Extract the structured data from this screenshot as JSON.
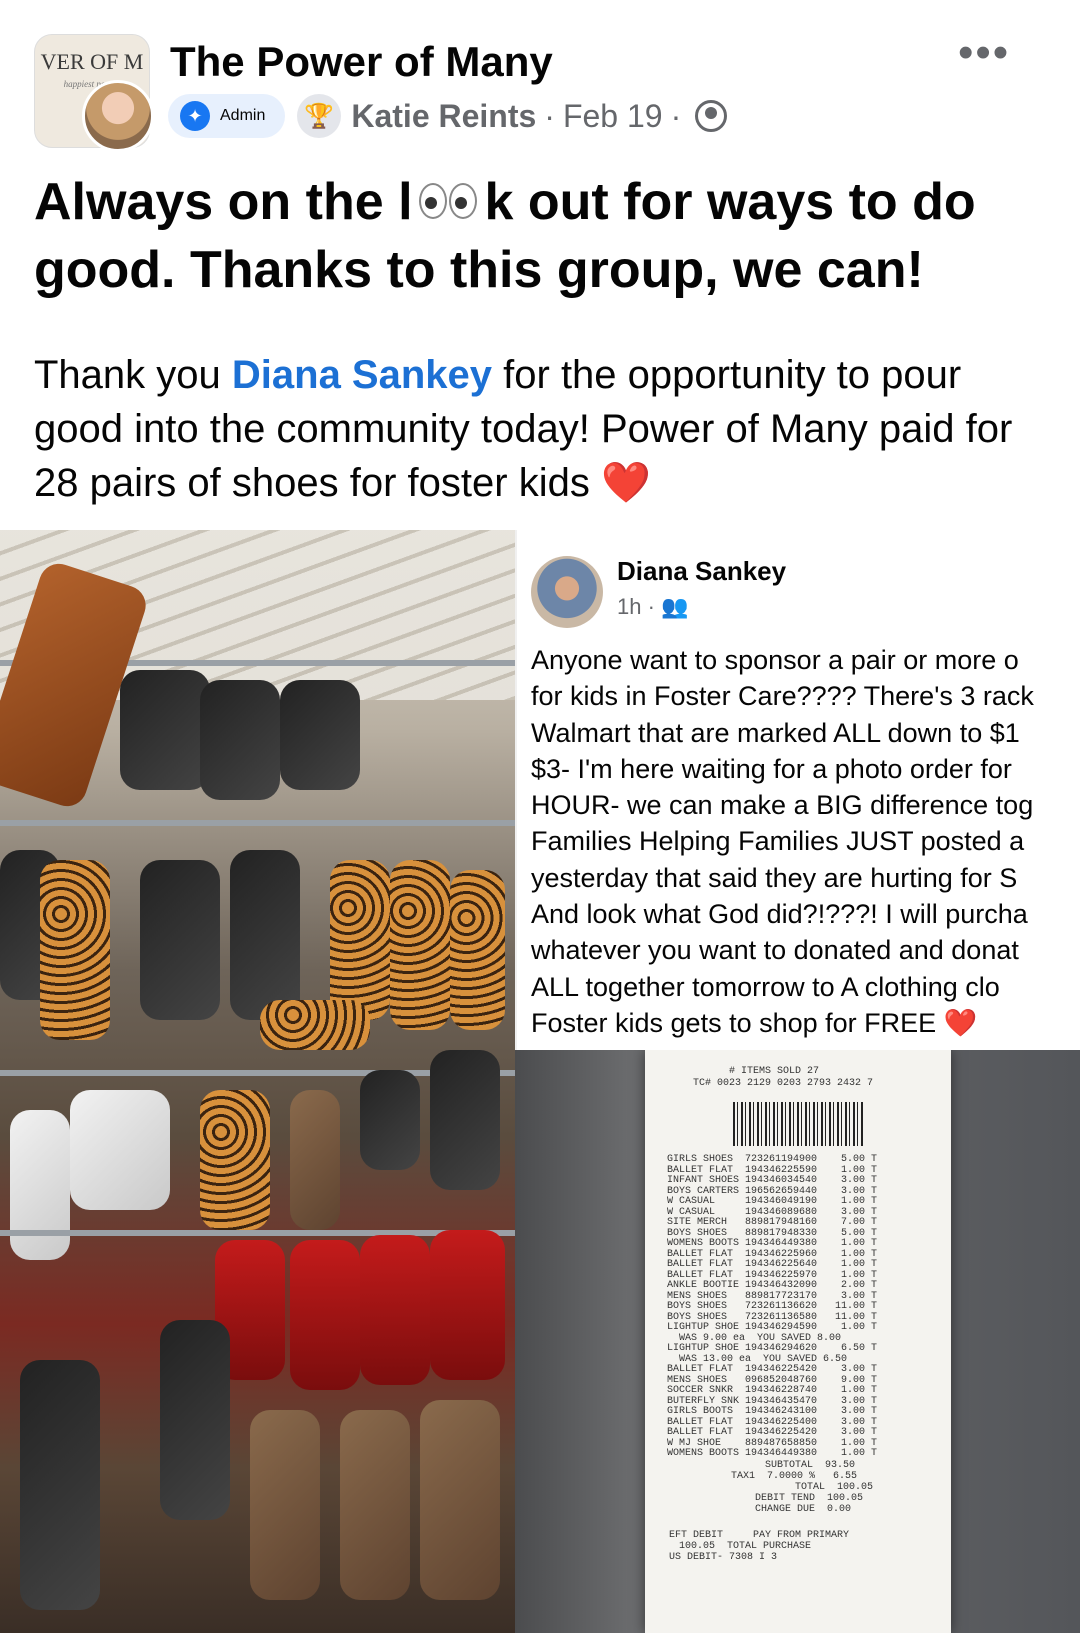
{
  "post": {
    "group_name": "The Power of Many",
    "group_logo_text": "VER OF M",
    "group_logo_sub": "happiest people",
    "admin_label": "Admin",
    "author": "Katie Reints",
    "date": "Feb 19",
    "headline_part1": "Always on the l",
    "headline_part2": "k out for ways to do good. Thanks to this group, we can!",
    "body_part1": "Thank you ",
    "mention": "Diana Sankey",
    "body_part2": " for the opportunity to pour good into the community today! Power of Many paid for 28 pairs of shoes for foster kids ",
    "heart": "❤️"
  },
  "shared_post": {
    "name": "Diana Sankey",
    "time": "1h ·",
    "text_lines": [
      "Anyone want to sponsor a pair or more o",
      "for kids in Foster Care???? There's 3 rack",
      "Walmart that are marked ALL down to $1",
      "$3- I'm here waiting for a photo order for",
      "HOUR- we can make a BIG difference tog",
      "Families Helping Families JUST posted a",
      "yesterday that said they are hurting for S",
      "And look what God did?!???! I will purcha",
      "whatever you want to donated and donat",
      "ALL together tomorrow to A clothing clo",
      "Foster kids gets to shop for FREE"
    ],
    "heart": "❤️"
  },
  "receipt": {
    "items_sold": "# ITEMS SOLD 27",
    "tc": "TC# 0023 2129 0203 2793 2432 7",
    "lines": [
      "GIRLS SHOES  723261194900    5.00 T",
      "BALLET FLAT  194346225590    1.00 T",
      "INFANT SHOES 194346034540    3.00 T",
      "BOYS CARTERS 196562659440    3.00 T",
      "W CASUAL     194346049190    1.00 T",
      "W CASUAL     194346089680    3.00 T",
      "SITE MERCH   889817948160    7.00 T",
      "BOYS SHOES   889817948330    5.00 T",
      "WOMENS BOOTS 194346449380    1.00 T",
      "BALLET FLAT  194346225960    1.00 T",
      "BALLET FLAT  194346225640    1.00 T",
      "BALLET FLAT  194346225970    1.00 T",
      "ANKLE BOOTIE 194346432090    2.00 T",
      "MENS SHOES   889817723170    3.00 T",
      "BOYS SHOES   723261136620   11.00 T",
      "BOYS SHOES   723261136580   11.00 T",
      "LIGHTUP SHOE 194346294590    1.00 T",
      "  WAS 9.00 ea  YOU SAVED 8.00",
      "LIGHTUP SHOE 194346294620    6.50 T",
      "  WAS 13.00 ea  YOU SAVED 6.50",
      "BALLET FLAT  194346225420    3.00 T",
      "MENS SHOES   096852048760    9.00 T",
      "SOCCER SNKR  194346228740    1.00 T",
      "BUTERFLY SNK 194346435470    3.00 T",
      "GIRLS BOOTS  194346243100    3.00 T",
      "BALLET FLAT  194346225400    3.00 T",
      "BALLET FLAT  194346225420    3.00 T",
      "W MJ SHOE    889487658850    1.00 T",
      "WOMENS BOOTS 194346449380    1.00 T"
    ],
    "subtotal_line": "SUBTOTAL  93.50",
    "tax_line": "TAX1  7.0000 %   6.55",
    "total_line": "TOTAL  100.05",
    "debit_line": "DEBIT TEND  100.05",
    "change_line": "CHANGE DUE  0.00",
    "eft_line": "EFT DEBIT     PAY FROM PRIMARY",
    "purchase_line": "100.05  TOTAL PURCHASE",
    "us_debit_line": "US DEBIT- 7308 I 3"
  }
}
